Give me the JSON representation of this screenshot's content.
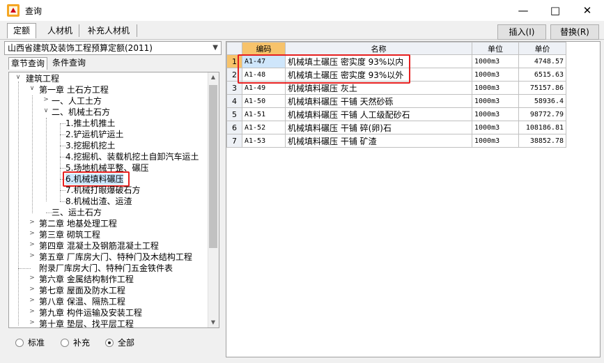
{
  "window": {
    "title": "查询"
  },
  "top_tabs": [
    "定额",
    "人材机",
    "补充人材机"
  ],
  "buttons": {
    "insert": "插入(I)",
    "replace": "替换(R)"
  },
  "quota_set": "山西省建筑及装饰工程预算定额(2011)",
  "sub_tabs": [
    "章节查询",
    "条件查询"
  ],
  "tree": {
    "root": "建筑工程",
    "ch1": "第一章 土石方工程",
    "s1": "一、人工土方",
    "s2": "二、机械土石方",
    "items": [
      "1.推土机推土",
      "2.铲运机铲运土",
      "3.挖掘机挖土",
      "4.挖掘机、装载机挖土自卸汽车运土",
      "5.场地机械平整、碾压",
      "6.机械填料碾压",
      "7.机械打眼爆破石方",
      "8.机械出渣、运渣"
    ],
    "s3": "三、运土石方",
    "chapters": [
      "第二章 地基处理工程",
      "第三章 砌筑工程",
      "第四章 混凝土及钢筋混凝土工程",
      "第五章 厂库房大门、特种门及木结构工程",
      "附录厂库房大门、特种门五金铁件表",
      "第六章 金属结构制作工程",
      "第七章 屋面及防水工程",
      "第八章 保温、隔热工程",
      "第九章 构件运输及安装工程",
      "第十章 垫层、找平层工程"
    ]
  },
  "filter": {
    "options": [
      "标准",
      "补充",
      "全部"
    ],
    "selected": "全部"
  },
  "grid": {
    "headers": [
      "编码",
      "名称",
      "单位",
      "单价"
    ],
    "rows": [
      {
        "n": "1",
        "code": "A1-47",
        "name": "机械填土碾压 密实度 93%以内",
        "unit": "1000m3",
        "price": "4748.57"
      },
      {
        "n": "2",
        "code": "A1-48",
        "name": "机械填土碾压 密实度 93%以外",
        "unit": "1000m3",
        "price": "6515.63"
      },
      {
        "n": "3",
        "code": "A1-49",
        "name": "机械填料碾压 灰土",
        "unit": "1000m3",
        "price": "75157.86"
      },
      {
        "n": "4",
        "code": "A1-50",
        "name": "机械填料碾压 干铺 天然砂砾",
        "unit": "1000m3",
        "price": "58936.4"
      },
      {
        "n": "5",
        "code": "A1-51",
        "name": "机械填料碾压 干铺 人工级配砂石",
        "unit": "1000m3",
        "price": "98772.79"
      },
      {
        "n": "6",
        "code": "A1-52",
        "name": "机械填料碾压 干铺 碎(卵)石",
        "unit": "1000m3",
        "price": "108186.81"
      },
      {
        "n": "7",
        "code": "A1-53",
        "name": "机械填料碾压 干铺 矿渣",
        "unit": "1000m3",
        "price": "38852.78"
      }
    ]
  },
  "colors": {
    "highlight": "#e61f1f",
    "selected_header": "#f7c36b",
    "selected_cell": "#cfe6fb"
  }
}
